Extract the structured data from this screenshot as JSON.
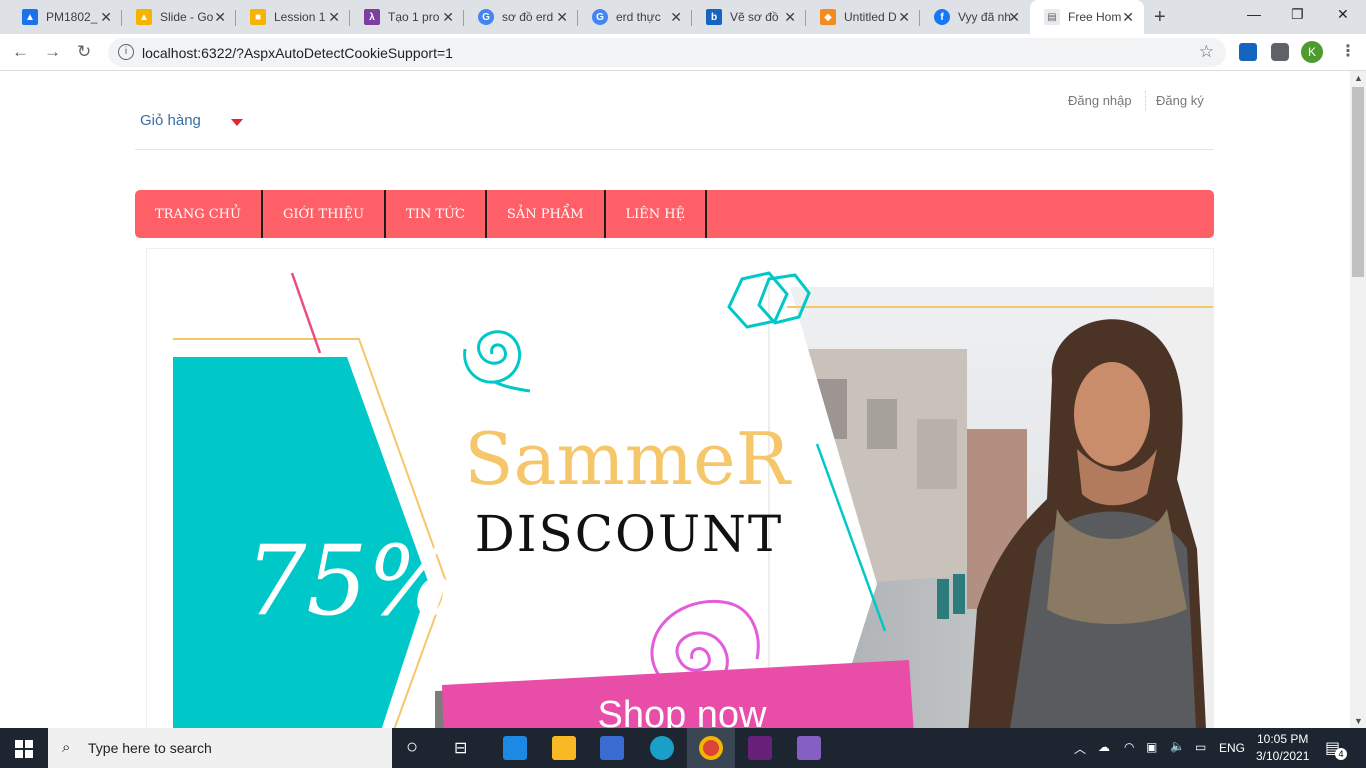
{
  "browser": {
    "tabs": [
      {
        "title": "PM1802_",
        "color": "#1a73e8",
        "glyph": "▲"
      },
      {
        "title": "Slide - Go",
        "color": "#f4b400",
        "glyph": "▲"
      },
      {
        "title": "Lession 1",
        "color": "#f4b400",
        "glyph": "■"
      },
      {
        "title": "Tạo 1 pro",
        "color": "#7b3fa0",
        "glyph": "λ"
      },
      {
        "title": "sơ đồ erd",
        "color": "#4285f4",
        "glyph": "G"
      },
      {
        "title": "erd thực",
        "color": "#4285f4",
        "glyph": "G"
      },
      {
        "title": "Vẽ sơ đồ",
        "color": "#1565c0",
        "glyph": "b"
      },
      {
        "title": "Untitled D",
        "color": "#f28c1e",
        "glyph": "◆"
      },
      {
        "title": "Vyy đã nh",
        "color": "#1877f2",
        "glyph": "f"
      },
      {
        "title": "Free Hom",
        "color": "#9aa0a6",
        "glyph": "▤"
      }
    ],
    "url": "localhost:6322/?AspxAutoDetectCookieSupport=1",
    "profile_initial": "K"
  },
  "header": {
    "cart_label": "Giỏ hàng",
    "login_label": "Đăng nhập",
    "register_label": "Đăng ký"
  },
  "nav": {
    "items": [
      "TRANG CHỦ",
      "GIỚI THIỆU",
      "TIN TỨC",
      "SẢN PHẨM",
      "LIÊN HỆ"
    ]
  },
  "banner": {
    "percent": "75%",
    "headline": "SammeR",
    "subheadline": "DISCOUNT",
    "cta": "Shop now",
    "colors": {
      "teal": "#00c8c8",
      "yellow": "#f5c76a",
      "pink": "#e84da8",
      "nav": "#ff5f67"
    }
  },
  "taskbar": {
    "search_placeholder": "Type here to search",
    "language": "ENG",
    "time": "10:05 PM",
    "date": "3/10/2021",
    "notifications": "4"
  }
}
